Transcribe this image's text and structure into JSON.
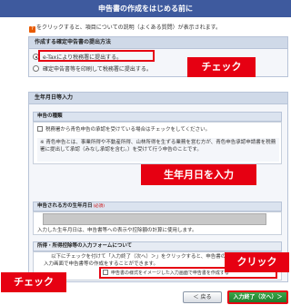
{
  "header": {
    "title": "申告書の作成をはじめる前に"
  },
  "help": {
    "icon": "question-icon",
    "icon_char": "?",
    "text": "をクリックすると、項目についての説明（よくある質問）が表示されます。"
  },
  "submission": {
    "heading": "作成する確定申告書の提出方法",
    "options": [
      {
        "label": "e-Taxにより税務署に提出する。",
        "selected": true
      },
      {
        "label": "確定申告書等を印刷して税務署に提出する。",
        "selected": false
      }
    ]
  },
  "birthdate_section": {
    "heading": "生年月日等入力",
    "return_type": {
      "heading": "申告の種類",
      "checkbox_label": "税務署から青色申告の承認を受けている場合はチェックをしてください。",
      "note_mark": "※",
      "note": "青色申告とは、事業所得や不動産所得、山林所得を生ずる業務を営む方が、青色申告承認申請書を税務署に提出して承認（みなし承認を含む。）を受けて行う申告のことです。"
    },
    "birthdate": {
      "label": "申告される方の生年月日",
      "required": "(必須)",
      "value": "",
      "note": "入力した生年月日は、申告書等への表示や控除額の計算に使用します。"
    },
    "form_choice": {
      "heading": "所得・所得控除等の入力フォームについて",
      "text": "以下にチェックを付けて「入力終了（次へ）＞」をクリックすると、申告書の様式をイメージした入力画面で申告書等の作成をすることができます。",
      "checkbox_label": "申告書の様式をイメージした入力画面で申告書を作成する"
    }
  },
  "annotations": {
    "check_1": "チェック",
    "birthdate": "生年月日を入力",
    "click": "クリック",
    "check_2": "チェック"
  },
  "buttons": {
    "back": "＜ 戻る",
    "next": "入力終了（次へ）＞"
  },
  "colors": {
    "header": "#3e5a9e",
    "callout": "#e60012",
    "next_button": "#2a8f38"
  }
}
